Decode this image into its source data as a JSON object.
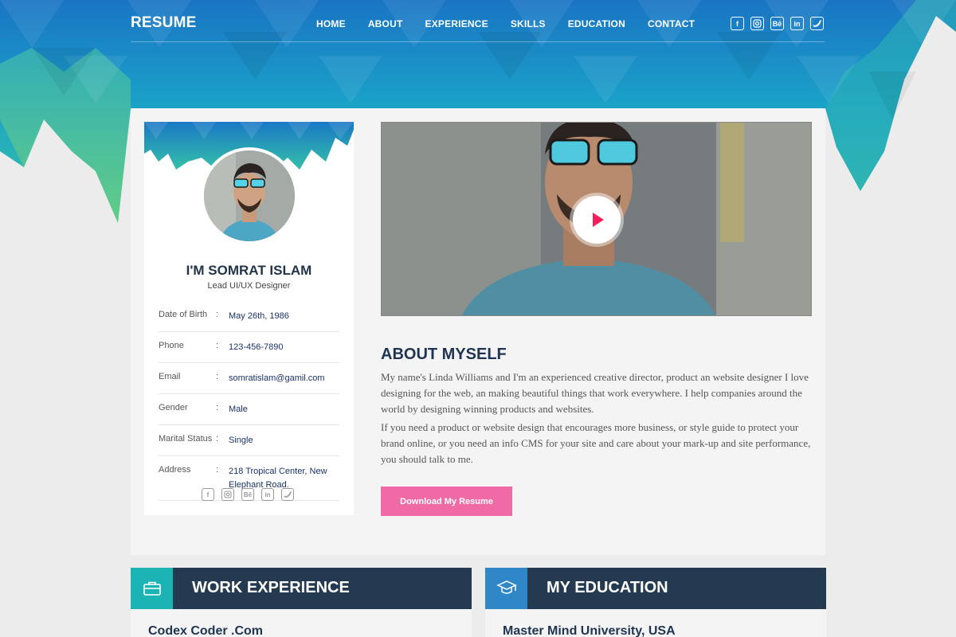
{
  "nav": {
    "logo": "RESUME",
    "menu": [
      "HOME",
      "ABOUT",
      "EXPERIENCE",
      "SKILLS",
      "EDUCATION",
      "CONTACT"
    ],
    "social": [
      "facebook-icon",
      "instagram-icon",
      "behance-icon",
      "linkedin-icon",
      "twitter-icon"
    ]
  },
  "profile": {
    "name": "I'M SOMRAT ISLAM",
    "role": "Lead UI/UX Designer",
    "info": [
      {
        "key": "Date of Birth",
        "value": "May 26th, 1986"
      },
      {
        "key": "Phone",
        "value": "123-456-7890"
      },
      {
        "key": "Email",
        "value": "somratislam@gamil.com"
      },
      {
        "key": "Gender",
        "value": "Male"
      },
      {
        "key": "Marital Status",
        "value": "Single"
      },
      {
        "key": "Address",
        "value": "218 Tropical Center, New Elephant Road."
      }
    ],
    "colon": ":"
  },
  "about": {
    "title": "ABOUT MYSELF",
    "p1": "My name's Linda Williams and I'm an experienced creative director, product an website designer I love designing for the web, an making beautiful things that work everywhere. I help companies around the world by designing winning products and websites.",
    "p2": "If you need a product or website design that encourages more business, or style guide to protect your brand online, or you need an info CMS for your site and care about your mark-up and site performance, you should talk to me.",
    "button": "Download My Resume"
  },
  "work": {
    "title": "WORK EXPERIENCE",
    "first_item": "Codex Coder .Com",
    "icon": "briefcase-icon",
    "accent": "#1bb3b3"
  },
  "education": {
    "title": "MY EDUCATION",
    "first_item": "Master Mind University, USA",
    "icon": "graduation-cap-icon",
    "accent": "#2f87c8"
  },
  "colors": {
    "header_dark": "#233a50",
    "button_pink": "#f06ba6",
    "play_red": "#ee1f5c"
  }
}
